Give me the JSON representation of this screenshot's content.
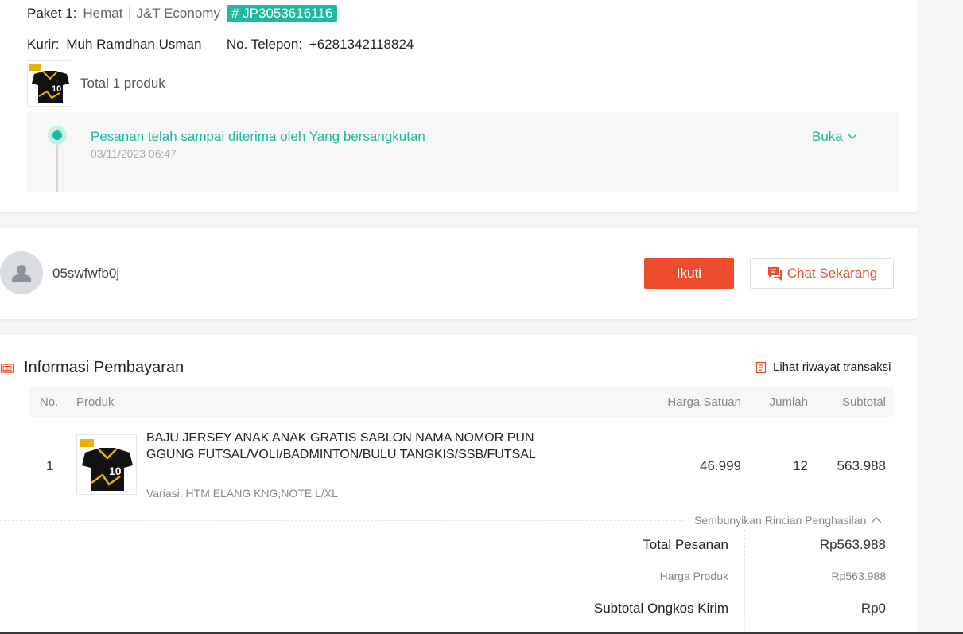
{
  "package": {
    "label": "Paket 1:",
    "service": "Hemat",
    "carrier": "J&T Economy",
    "tracking_tag": "# JP3053616116",
    "courier_label": "Kurir:",
    "courier_name": "Muh Ramdhan Usman",
    "phone_label": "No. Telepon:",
    "phone": "+6281342118824",
    "total_products": "Total 1 produk",
    "tracking": {
      "status": "Pesanan telah sampai diterima oleh Yang bersangkutan",
      "timestamp": "03/11/2023 06:47",
      "open_label": "Buka"
    }
  },
  "seller": {
    "username": "05swfwfb0j",
    "follow_label": "Ikuti",
    "chat_label": "Chat Sekarang"
  },
  "payment": {
    "title": "Informasi Pembayaran",
    "history_link": "Lihat riwayat transaksi",
    "columns": {
      "no": "No.",
      "product": "Produk",
      "unit_price": "Harga Satuan",
      "qty": "Jumlah",
      "subtotal": "Subtotal"
    },
    "items": [
      {
        "no": "1",
        "name": "BAJU JERSEY ANAK ANAK GRATIS SABLON NAMA NOMOR PUNGGUNG FUTSAL/VOLI/BADMINTON/BULU TANGKIS/SSB/FUTSAL",
        "variant": "Variasi: HTM ELANG KNG,NOTE L/XL",
        "unit_price": "46.999",
        "qty": "12",
        "subtotal": "563.988"
      }
    ],
    "toggle_detail": "Sembunyikan Rincian Penghasilan",
    "summary": {
      "total_order_label": "Total Pesanan",
      "total_order_value": "Rp563.988",
      "product_price_label": "Harga Produk",
      "product_price_value": "Rp563.988",
      "shipping_subtotal_label": "Subtotal Ongkos Kirim",
      "shipping_subtotal_value": "Rp0"
    }
  },
  "colors": {
    "brand": "#ee4d2d",
    "teal": "#1fb99f"
  }
}
